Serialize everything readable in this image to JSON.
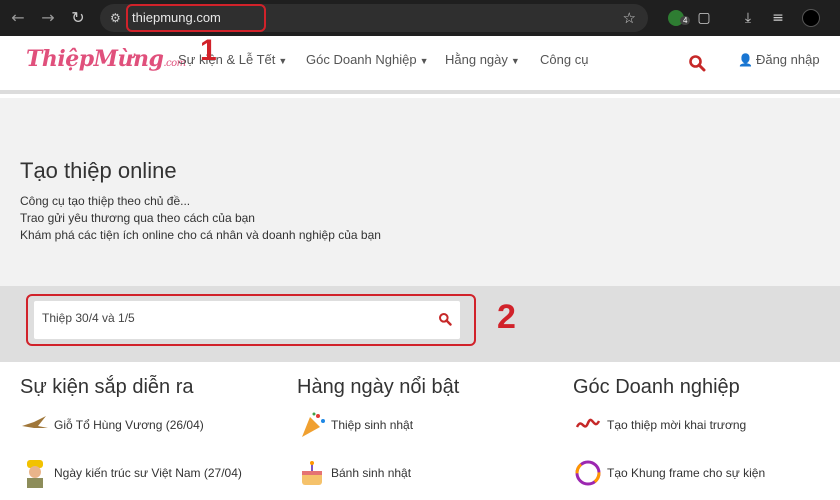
{
  "browser": {
    "url": "thiepmung.com",
    "extension_badge": "4"
  },
  "site": {
    "logo_main": "ThiệpMừng",
    "logo_suffix": ".com",
    "menu": [
      {
        "label": "Sự kiện & Lễ Tết"
      },
      {
        "label": "Góc Doanh Nghiệp"
      },
      {
        "label": "Hằng ngày"
      },
      {
        "label": "Công cụ"
      }
    ],
    "login_label": "Đăng nhập"
  },
  "hero": {
    "title": "Tạo thiệp online",
    "lines": [
      "Công cụ tạo thiệp theo chủ đề...",
      "Trao gửi yêu thương qua theo cách của bạn",
      "Khám phá các tiện ích online cho cá nhân và doanh nghiệp của bạn"
    ]
  },
  "search": {
    "value": "Thiệp 30/4 và 1/5"
  },
  "annotations": {
    "one": "1",
    "two": "2"
  },
  "sections": [
    {
      "title": "Sự kiện sắp diễn ra",
      "items": [
        {
          "label": "Giỗ Tổ Hùng Vương (26/04)",
          "icon": "bird-icon"
        },
        {
          "label": "Ngày kiến trúc sư Việt Nam (27/04)",
          "icon": "architect-icon"
        }
      ]
    },
    {
      "title": "Hàng ngày nổi bật",
      "items": [
        {
          "label": "Thiệp sinh nhật",
          "icon": "party-popper-icon"
        },
        {
          "label": "Bánh sinh nhật",
          "icon": "cake-icon"
        }
      ]
    },
    {
      "title": "Góc Doanh nghiệp",
      "items": [
        {
          "label": "Tạo thiệp mời khai trương",
          "icon": "ribbon-icon"
        },
        {
          "label": "Tạo Khung frame cho sự kiện",
          "icon": "ring-frame-icon"
        }
      ]
    }
  ],
  "colors": {
    "accent": "#d1222a",
    "logo": "#e0507c",
    "search_icon": "#c62828"
  }
}
